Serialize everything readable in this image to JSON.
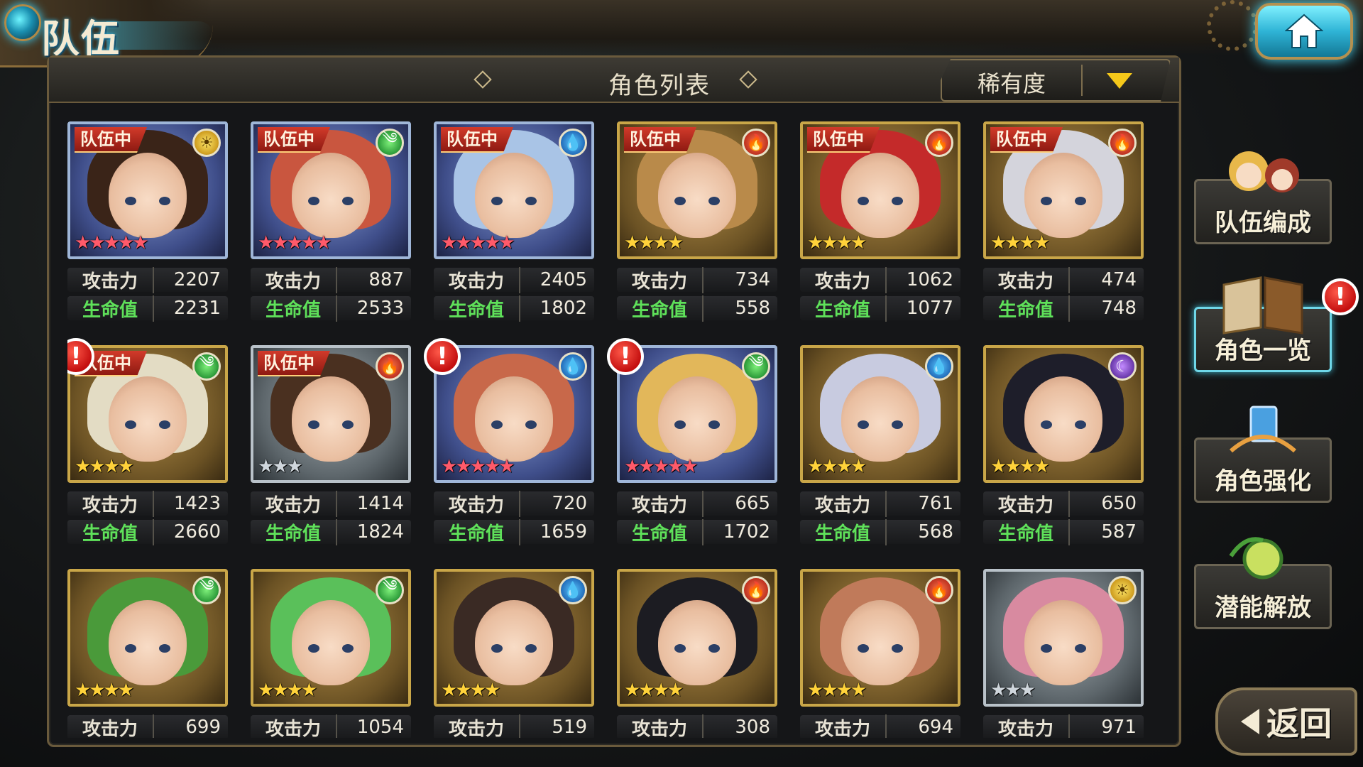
{
  "header": {
    "title": "队伍",
    "home_icon": "home-icon"
  },
  "panel": {
    "title": "角色列表",
    "sort_label": "稀有度",
    "sort_icon": "dropdown-triangle-icon"
  },
  "labels": {
    "team_tag": "队伍中",
    "atk": "攻击力",
    "hp": "生命值"
  },
  "colors": {
    "accent_gold": "#c9a648",
    "atk_label": "#e7e2d4",
    "hp_label": "#5fe15a",
    "team_tag": "#d23a2a",
    "alert": "#c40f0f",
    "home_button": "#2fb4d6"
  },
  "characters": [
    {
      "team": true,
      "alert": false,
      "element": "light",
      "stars": 5,
      "frame": "blue",
      "hair": "#3a2418",
      "atk": "2207",
      "hp": "2231"
    },
    {
      "team": true,
      "alert": false,
      "element": "wind",
      "stars": 5,
      "frame": "blue",
      "hair": "#c9563f",
      "atk": "887",
      "hp": "2533"
    },
    {
      "team": true,
      "alert": false,
      "element": "water",
      "stars": 5,
      "frame": "blue",
      "hair": "#a9c4e6",
      "atk": "2405",
      "hp": "1802"
    },
    {
      "team": true,
      "alert": false,
      "element": "fire",
      "stars": 4,
      "frame": "gold",
      "hair": "#b98a4a",
      "atk": "734",
      "hp": "558"
    },
    {
      "team": true,
      "alert": false,
      "element": "fire",
      "stars": 4,
      "frame": "gold",
      "hair": "#c42a2a",
      "atk": "1062",
      "hp": "1077"
    },
    {
      "team": true,
      "alert": false,
      "element": "fire",
      "stars": 4,
      "frame": "gold",
      "hair": "#d4d4dc",
      "atk": "474",
      "hp": "748"
    },
    {
      "team": true,
      "alert": true,
      "element": "wind",
      "stars": 4,
      "frame": "gold",
      "hair": "#e3dcc4",
      "atk": "1423",
      "hp": "2660"
    },
    {
      "team": true,
      "alert": false,
      "element": "fire",
      "stars": 3,
      "frame": "silver",
      "hair": "#4a3020",
      "atk": "1414",
      "hp": "1824"
    },
    {
      "team": false,
      "alert": true,
      "element": "water",
      "stars": 5,
      "frame": "blue",
      "hair": "#c8684a",
      "atk": "720",
      "hp": "1659"
    },
    {
      "team": false,
      "alert": true,
      "element": "wind",
      "stars": 5,
      "frame": "blue",
      "hair": "#e2b75a",
      "atk": "665",
      "hp": "1702"
    },
    {
      "team": false,
      "alert": false,
      "element": "water",
      "stars": 4,
      "frame": "gold",
      "hair": "#c8cbe0",
      "atk": "761",
      "hp": "568"
    },
    {
      "team": false,
      "alert": false,
      "element": "dark",
      "stars": 4,
      "frame": "gold",
      "hair": "#1e1e2a",
      "atk": "650",
      "hp": "587"
    },
    {
      "team": false,
      "alert": false,
      "element": "wind",
      "stars": 4,
      "frame": "gold",
      "hair": "#4a9a3a",
      "atk": "699",
      "hp": ""
    },
    {
      "team": false,
      "alert": false,
      "element": "wind",
      "stars": 4,
      "frame": "gold",
      "hair": "#5ac05a",
      "atk": "1054",
      "hp": ""
    },
    {
      "team": false,
      "alert": false,
      "element": "water",
      "stars": 4,
      "frame": "gold",
      "hair": "#3a2a24",
      "atk": "519",
      "hp": ""
    },
    {
      "team": false,
      "alert": false,
      "element": "fire",
      "stars": 4,
      "frame": "gold",
      "hair": "#1c1c22",
      "atk": "308",
      "hp": ""
    },
    {
      "team": false,
      "alert": false,
      "element": "fire",
      "stars": 4,
      "frame": "gold",
      "hair": "#c07a5a",
      "atk": "694",
      "hp": ""
    },
    {
      "team": false,
      "alert": false,
      "element": "light",
      "stars": 3,
      "frame": "silver",
      "hair": "#d88aa0",
      "atk": "971",
      "hp": ""
    }
  ],
  "side_menu": {
    "team_edit": "队伍编成",
    "char_list": "角色一览",
    "enhance": "角色强化",
    "potential": "潜能解放",
    "alert_mark": "!"
  },
  "back_button": {
    "label": "返回"
  }
}
